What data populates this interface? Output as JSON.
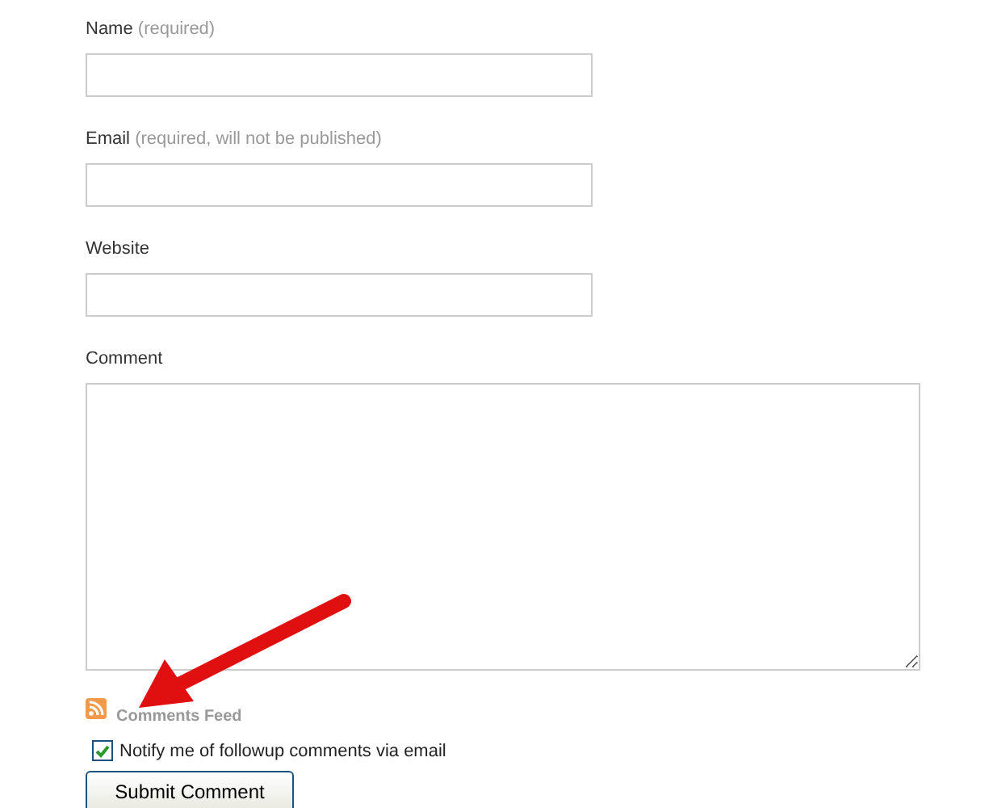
{
  "fields": [
    {
      "label": "Name",
      "hint": "(required)",
      "kind": "input"
    },
    {
      "label": "Email",
      "hint": "(required, will not be published)",
      "kind": "input"
    },
    {
      "label": "Website",
      "kind": "input"
    },
    {
      "label": "Comment",
      "kind": "textarea"
    }
  ],
  "feed_link": "Comments Feed",
  "notify": {
    "label": "Notify me of followup comments via email",
    "checked": true
  },
  "submit": "Submit Comment"
}
